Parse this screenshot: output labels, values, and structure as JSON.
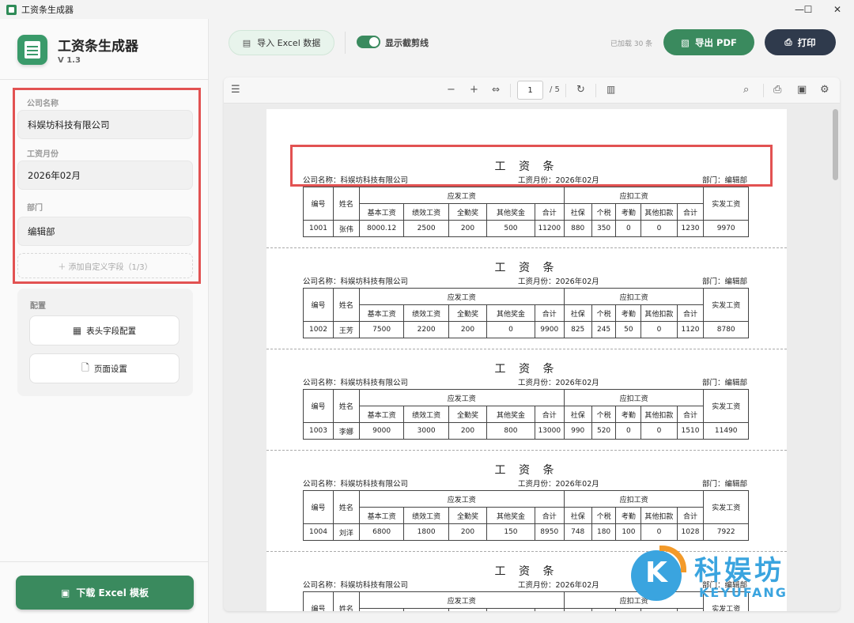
{
  "window": {
    "title": "工资条生成器",
    "minimize": "—",
    "maximize": "☐",
    "close": "✕"
  },
  "brand": {
    "name": "工资条生成器",
    "version": "V 1.3"
  },
  "form": {
    "company_label": "公司名称",
    "company_value": "科娱坊科技有限公司",
    "month_label": "工资月份",
    "month_value": "2026年02月",
    "dept_label": "部门",
    "dept_value": "编辑部",
    "add_field": "＋ 添加自定义字段（1/3）"
  },
  "config": {
    "label": "配置",
    "header_btn": "表头字段配置",
    "page_btn": "页面设置"
  },
  "download_btn": "下载 Excel 模板",
  "toolbar": {
    "import_btn": "导入 Excel 数据",
    "cutline_label": "显示截剪线",
    "cutline_on": true,
    "loaded": "已加载 30 条",
    "export_btn": "导出 PDF",
    "print_btn": "打印"
  },
  "viewer": {
    "page_current": "1",
    "page_total": "/ 5"
  },
  "slip": {
    "title": "工 资 条",
    "company": "公司名称：科娱坊科技有限公司",
    "month": "工资月份：2026年02月",
    "dept": "部门：编辑部",
    "h_id": "编号",
    "h_name": "姓名",
    "h_pay": "应发工资",
    "h_deduct": "应扣工资",
    "h_net": "实发工资",
    "sub": [
      "基本工资",
      "绩效工资",
      "全勤奖",
      "其他奖金",
      "合计",
      "社保",
      "个税",
      "考勤",
      "其他扣款",
      "合计"
    ]
  },
  "rows": [
    [
      "1001",
      "张伟",
      "8000.12",
      "2500",
      "200",
      "500",
      "11200",
      "880",
      "350",
      "0",
      "0",
      "1230",
      "9970"
    ],
    [
      "1002",
      "王芳",
      "7500",
      "2200",
      "200",
      "0",
      "9900",
      "825",
      "245",
      "50",
      "0",
      "1120",
      "8780"
    ],
    [
      "1003",
      "李娜",
      "9000",
      "3000",
      "200",
      "800",
      "13000",
      "990",
      "520",
      "0",
      "0",
      "1510",
      "11490"
    ],
    [
      "1004",
      "刘洋",
      "6800",
      "1800",
      "200",
      "150",
      "8950",
      "748",
      "180",
      "100",
      "0",
      "1028",
      "7922"
    ]
  ],
  "watermark": {
    "cn": "科娱坊",
    "en": "KEYUFANG",
    "letter": "K"
  },
  "colors": {
    "accent": "#3a8a5e",
    "dark": "#2f3a4c",
    "highlight": "#e25252"
  }
}
